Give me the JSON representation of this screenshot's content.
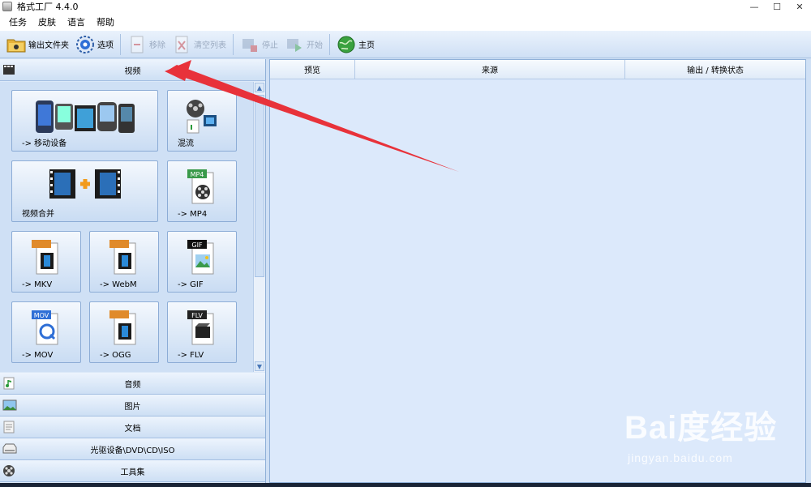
{
  "window": {
    "title": "格式工厂 4.4.0",
    "minimize": "—",
    "maximize": "☐",
    "close": "✕"
  },
  "menu": [
    "任务",
    "皮肤",
    "语言",
    "帮助"
  ],
  "toolbar": {
    "output_folder": "输出文件夹",
    "options": "选项",
    "remove": "移除",
    "clear_list": "清空列表",
    "stop": "停止",
    "start": "开始",
    "home": "主页"
  },
  "categories": {
    "video": "视频",
    "audio": "音频",
    "picture": "图片",
    "document": "文档",
    "optical": "光驱设备\\DVD\\CD\\ISO",
    "tools": "工具集"
  },
  "tiles": {
    "mobile": "-> 移动设备",
    "mux": "混流",
    "merge": "视频合并",
    "mp4": "-> MP4",
    "mkv": "-> MKV",
    "webm": "-> WebM",
    "gif": "-> GIF",
    "mov": "-> MOV",
    "ogg": "-> OGG",
    "flv": "-> FLV"
  },
  "tile_badges": {
    "mp4": "MP4",
    "gif": "GIF",
    "mov": "MOV",
    "flv": "FLV"
  },
  "columns": {
    "preview": "预览",
    "source": "来源",
    "output": "输出 / 转换状态"
  },
  "watermark": {
    "main": "Bai度经验",
    "sub": "jingyan.baidu.com"
  },
  "colors": {
    "arrow": "#e8323a",
    "accent": "#2f6fd6"
  }
}
